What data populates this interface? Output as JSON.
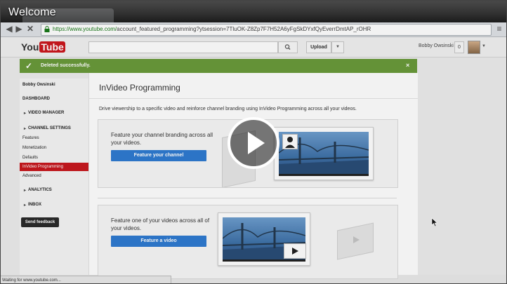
{
  "overlay": {
    "title": "Welcome"
  },
  "browser": {
    "url_secure": "https://www.youtube.com/",
    "url_rest": "account_featured_programming?ytsession=7TluOK-Z8Zp7F7H52A6yFgSkDYxfQyEverrDmtAP_rOHR"
  },
  "header": {
    "logo_you": "You",
    "logo_tube": "Tube",
    "upload_label": "Upload",
    "user_name": "Bobby Owsinski",
    "notifications_count": "0"
  },
  "alert": {
    "message": "Deleted successfully."
  },
  "sidebar": {
    "user": "Bobby Owsinski",
    "dashboard": "DASHBOARD",
    "video_manager": "VIDEO MANAGER",
    "channel_settings": "CHANNEL SETTINGS",
    "features": "Features",
    "monetization": "Monetization",
    "defaults": "Defaults",
    "invideo": "InVideo Programming",
    "advanced": "Advanced",
    "analytics": "ANALYTICS",
    "inbox": "INBOX",
    "feedback": "Send feedback"
  },
  "main": {
    "title": "InVideo Programming",
    "intro": "Drive viewership to a specific video and reinforce channel branding using InVideo Programming across all your videos.",
    "panel1": {
      "desc": "Feature your channel branding across all your videos.",
      "button": "Feature your channel"
    },
    "panel2": {
      "desc": "Feature one of your videos across all of your videos.",
      "button": "Feature a video"
    }
  },
  "status": {
    "text": "Waiting for www.youtube.com..."
  },
  "colors": {
    "youtube_red": "#cc181e",
    "success_green": "#6a9a3a",
    "action_blue": "#2f7bd1"
  }
}
